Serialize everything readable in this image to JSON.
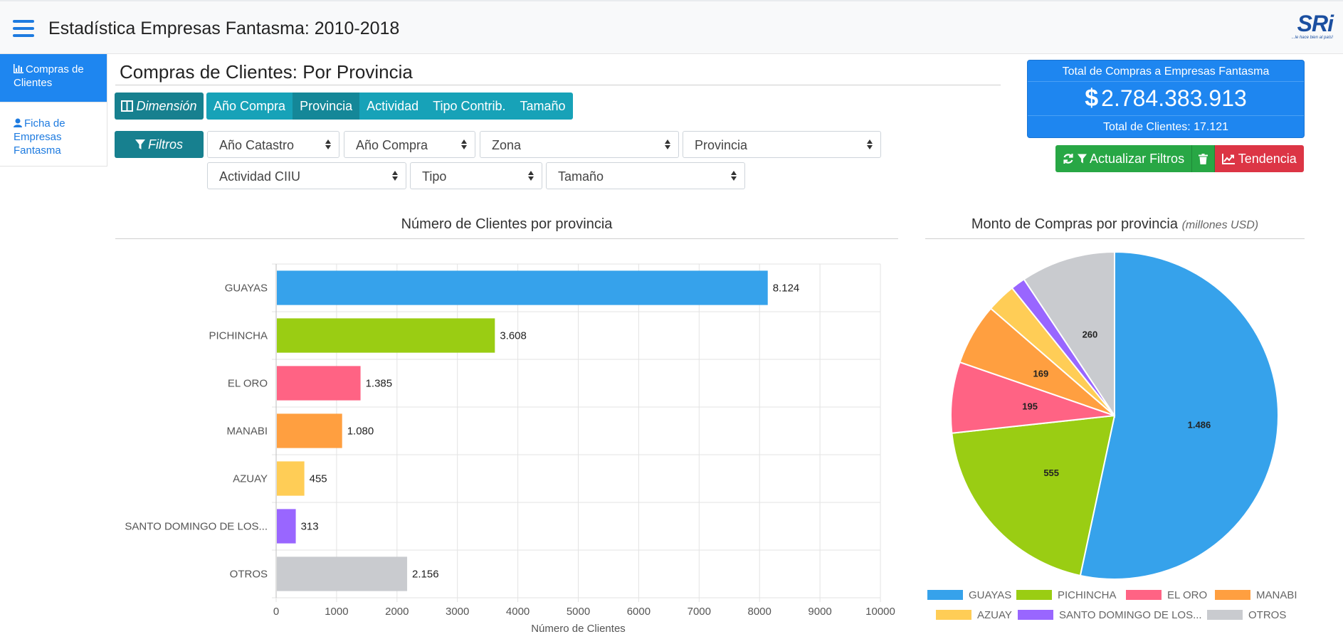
{
  "header": {
    "title": "Estadística Empresas Fantasma: 2010-2018",
    "logo_text": "SRi",
    "logo_tagline": "...le hace bien al país!"
  },
  "sidebar": {
    "items": [
      {
        "label": "Compras de Clientes",
        "icon": "bar-chart-icon",
        "active": true
      },
      {
        "label": "Ficha de Empresas Fantasma",
        "icon": "user-icon",
        "active": false
      }
    ]
  },
  "page": {
    "title": "Compras de Clientes: Por Provincia"
  },
  "dimension": {
    "label": "Dimensión",
    "options": [
      "Año Compra",
      "Provincia",
      "Actividad",
      "Tipo Contrib.",
      "Tamaño"
    ],
    "selected": "Provincia"
  },
  "filters": {
    "label": "Filtros",
    "selects": [
      "Año Catastro",
      "Año Compra",
      "Zona",
      "Provincia",
      "Actividad CIIU",
      "Tipo",
      "Tamaño"
    ]
  },
  "totals": {
    "label": "Total de Compras a Empresas Fantasma",
    "currency_symbol": "$",
    "amount": "2.784.383.913",
    "clients": "Total de Clientes: 17.121"
  },
  "actions": {
    "update_label": "Actualizar Filtros",
    "trend_label": "Tendencia"
  },
  "colors": {
    "primary": "#1e86f0",
    "teal": "#17a2b8",
    "green": "#28a745",
    "red": "#dc3545"
  },
  "chart_data": [
    {
      "type": "bar",
      "orientation": "horizontal",
      "title": "Número de Clientes por provincia",
      "xlabel": "Número de Clientes",
      "ylabel": "",
      "xlim": [
        0,
        10000
      ],
      "ticks": [
        "0",
        "1000",
        "2000",
        "3000",
        "4000",
        "5000",
        "6000",
        "7000",
        "8000",
        "9000",
        "10000"
      ],
      "grid": true,
      "categories": [
        "GUAYAS",
        "PICHINCHA",
        "EL ORO",
        "MANABI",
        "AZUAY",
        "SANTO DOMINGO DE LOS...",
        "OTROS"
      ],
      "values": [
        8124,
        3608,
        1385,
        1080,
        455,
        313,
        2156
      ],
      "value_labels": [
        "8.124",
        "3.608",
        "1.385",
        "1.080",
        "455",
        "313",
        "2.156"
      ],
      "colors": [
        "#36a2eb",
        "#9acd13",
        "#ff6384",
        "#ff9f40",
        "#ffcd56",
        "#9966ff",
        "#c9cbcf"
      ]
    },
    {
      "type": "pie",
      "title": "Monto de Compras por provincia",
      "subtitle": "(millones USD)",
      "categories": [
        "GUAYAS",
        "PICHINCHA",
        "EL ORO",
        "MANABI",
        "AZUAY",
        "SANTO DOMINGO DE LOS...",
        "OTROS"
      ],
      "values": [
        1486,
        555,
        195,
        169,
        80,
        40,
        260
      ],
      "value_labels": [
        "1.486",
        "555",
        "195",
        "169",
        "",
        "",
        "260"
      ],
      "colors": [
        "#36a2eb",
        "#9acd13",
        "#ff6384",
        "#ff9f40",
        "#ffcd56",
        "#9966ff",
        "#c9cbcf"
      ],
      "legend": "bottom"
    }
  ]
}
